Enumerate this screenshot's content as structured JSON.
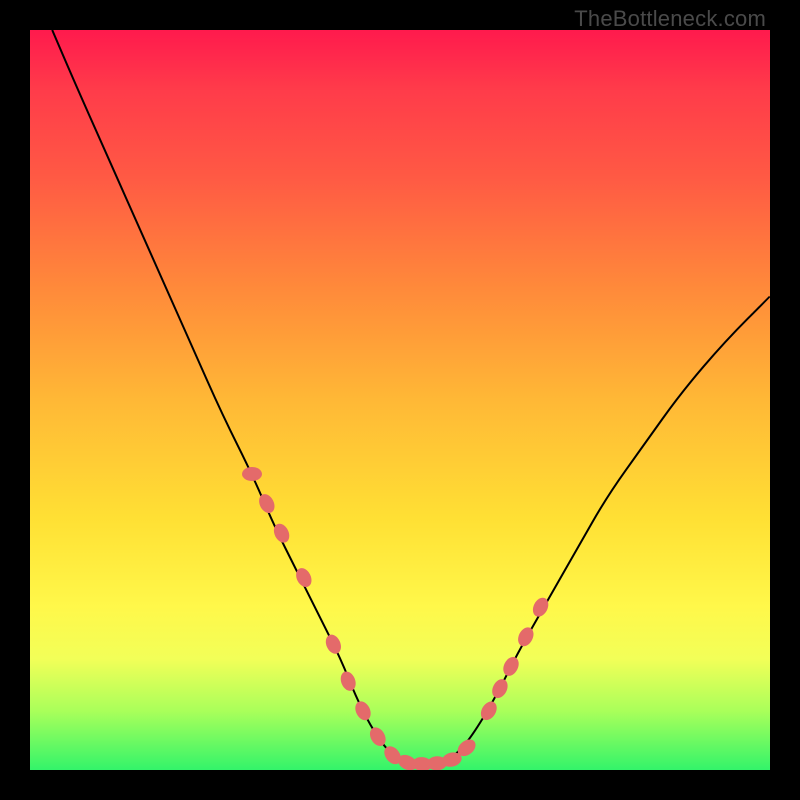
{
  "watermark": "TheBottleneck.com",
  "colors": {
    "frame": "#000000",
    "marker": "#e46a6a",
    "line": "#000000",
    "gradient_stops": [
      "#ff1a4d",
      "#ff5a44",
      "#ffb836",
      "#fff84a",
      "#33f46a"
    ]
  },
  "chart_data": {
    "type": "line",
    "title": "",
    "xlabel": "",
    "ylabel": "",
    "xlim": [
      0,
      100
    ],
    "ylim": [
      0,
      100
    ],
    "note": "x and y are percent of plot area; y=0 is bottom. V-shaped bottleneck curve with flat minimum.",
    "series": [
      {
        "name": "curve",
        "x": [
          3,
          6,
          10,
          14,
          18,
          22,
          26,
          30,
          33,
          36,
          39,
          42,
          44,
          46,
          48,
          50,
          52,
          54,
          56,
          58,
          60,
          63,
          66,
          70,
          74,
          78,
          83,
          88,
          94,
          100
        ],
        "y": [
          100,
          93,
          84,
          75,
          66,
          57,
          48,
          40,
          33,
          27,
          21,
          15,
          10,
          6,
          3,
          1.2,
          0.6,
          0.6,
          1,
          2.5,
          5,
          10,
          16,
          23,
          30,
          37,
          44,
          51,
          58,
          64
        ]
      }
    ],
    "markers": {
      "name": "highlighted-points",
      "note": "Salmon lozenge markers near the valley and along both lower arms.",
      "x": [
        30,
        32,
        34,
        37,
        41,
        43,
        45,
        47,
        49,
        51,
        53,
        55,
        57,
        59,
        62,
        63.5,
        65,
        67,
        69
      ],
      "y": [
        40,
        36,
        32,
        26,
        17,
        12,
        8,
        4.5,
        2,
        1,
        0.8,
        0.9,
        1.4,
        3,
        8,
        11,
        14,
        18,
        22
      ]
    }
  }
}
